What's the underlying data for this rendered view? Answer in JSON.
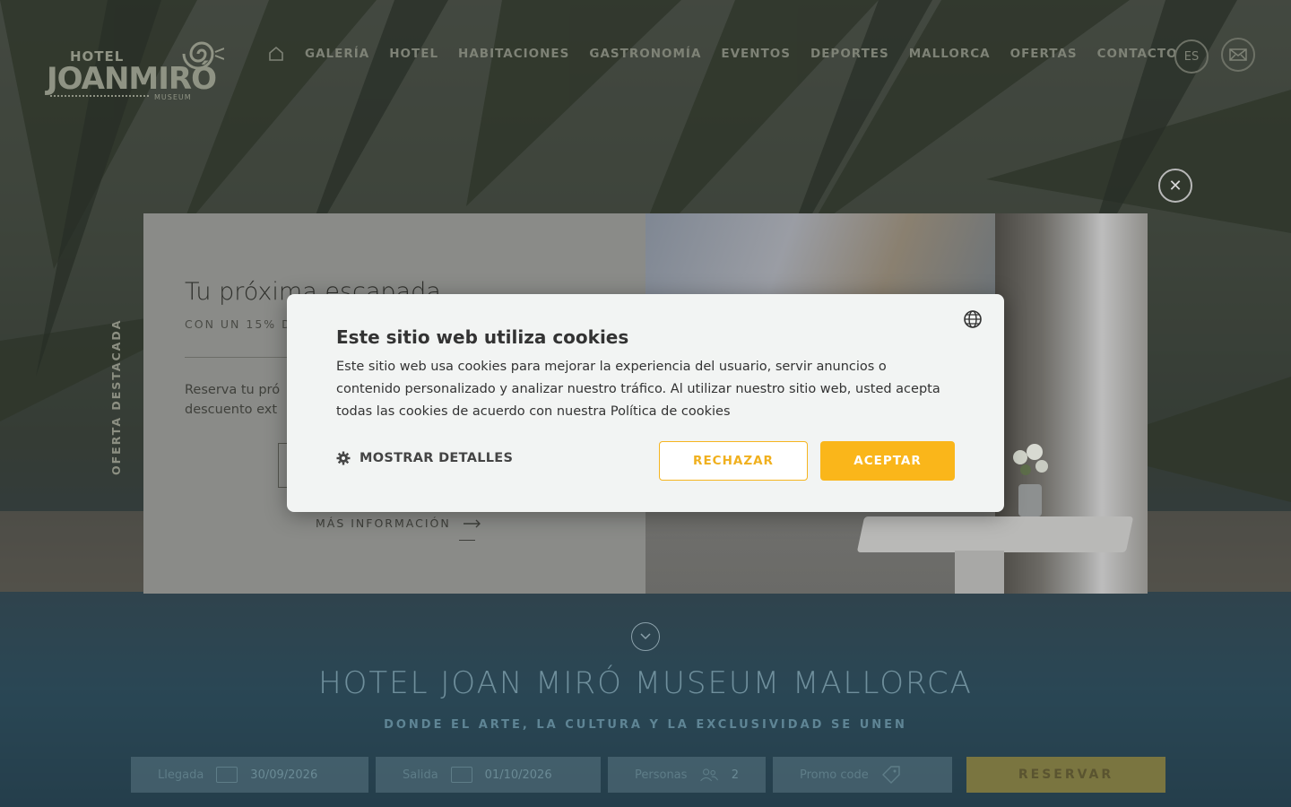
{
  "header": {
    "logo": {
      "line1": "HOTEL",
      "line2": "JOANMIRÓ",
      "line3": "MUSEUM"
    },
    "nav": [
      "GALERÍA",
      "HOTEL",
      "HABITACIONES",
      "GASTRONOMÍA",
      "EVENTOS",
      "DEPORTES",
      "MALLORCA",
      "OFERTAS",
      "CONTACTO"
    ],
    "language": "ES",
    "icons": {
      "home": "home-icon",
      "mail": "mail-icon"
    }
  },
  "offer_modal": {
    "side_label": "OFERTA DESTACADA",
    "title": "Tu próxima escapada",
    "subtitle": "CON UN 15% D",
    "description_line1": "Reserva tu pró",
    "description_line2": "descuento ext",
    "more_info": "MÁS INFORMACIÓN",
    "close_icon": "close-icon"
  },
  "cookie_banner": {
    "title": "Este sitio web utiliza cookies",
    "body": "Este sitio web usa cookies para mejorar la experiencia del usuario, servir anuncios o contenido personalizado y analizar nuestro tráfico. Al utilizar nuestro sitio web, usted acepta todas las cookies de acuerdo con nuestra Política de cookies",
    "show_details": "MOSTRAR DETALLES",
    "reject": "RECHAZAR",
    "accept": "ACEPTAR",
    "accent_color": "#fab61a"
  },
  "hero": {
    "title": "HOTEL JOAN MIRÓ MUSEUM MALLORCA",
    "subtitle": "DONDE EL ARTE, LA CULTURA Y LA EXCLUSIVIDAD SE UNEN"
  },
  "booking": {
    "arrival_label": "Llegada",
    "arrival_value": "30/09/2026",
    "departure_label": "Salida",
    "departure_value": "01/10/2026",
    "persons_label": "Personas",
    "persons_value": "2",
    "promo_label": "Promo code",
    "book_button": "RESERVAR"
  }
}
